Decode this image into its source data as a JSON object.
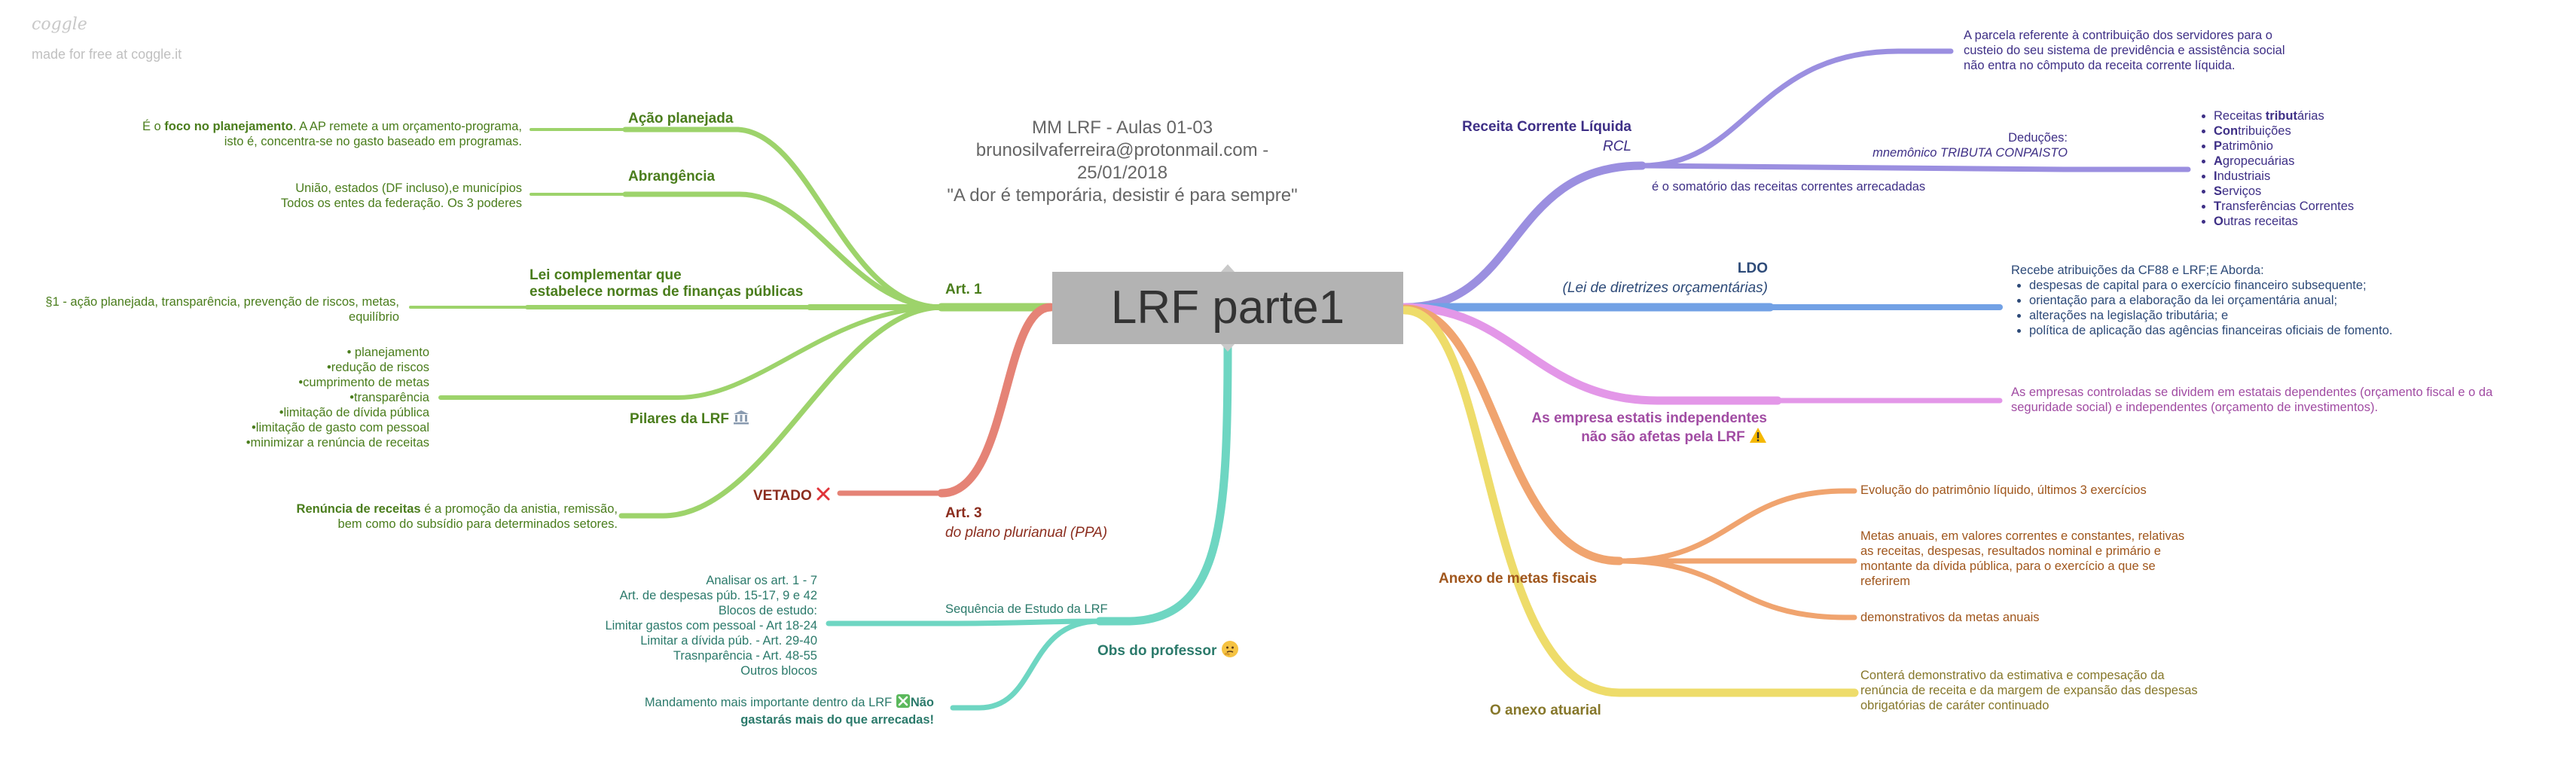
{
  "brand": {
    "logo": "coggle",
    "made_free": "made for free at coggle.it"
  },
  "header": {
    "line1": "MM LRF - Aulas 01-03",
    "line2": "brunosilvaferreira@protonmail.com - 25/01/2018",
    "line3": "\"A dor é temporária, desistir é para sempre\""
  },
  "central": "LRF parte1",
  "art1": {
    "label": "Art. 1",
    "acao": {
      "title": "Ação planejada",
      "note_pre": "É o ",
      "note_bold": "foco no planejamento",
      "note_post": ". A AP remete a um orçamento-programa,",
      "note_line2": "isto é, concentra-se no gasto baseado em programas."
    },
    "abrangencia": {
      "title": "Abrangência",
      "note_line1": "União, estados (DF incluso),e municípios",
      "note_line2": "Todos os entes da federação. Os 3 poderes"
    },
    "lei": {
      "title_line1": "Lei complementar que",
      "title_line2": "estabelece normas de finanças públicas",
      "note_line1": "§1 - ação planejada, transparência, prevenção de riscos, metas,",
      "note_line2": "equilíbrio"
    },
    "pilares": {
      "title": "Pilares da LRF",
      "icon": "bank-icon",
      "items": [
        "• planejamento",
        "•redução de riscos",
        "•cumprimento de metas",
        "•transparência",
        "•limitação de dívida pública",
        "•limitação de gasto com pessoal",
        "•minimizar a renúncia de receitas"
      ]
    },
    "renuncia": {
      "note_bold": "Renúncia de receitas",
      "note_post": " é a promoção da anistia, remissão,",
      "note_line2": "bem como do subsídio para determinados setores."
    }
  },
  "art3": {
    "title": "Art. 3",
    "subtitle": "do plano plurianual (PPA)",
    "vetado": "VETADO",
    "vetado_icon": "red-x-icon"
  },
  "obs": {
    "title": "Obs do professor",
    "icon": "thinking-face-icon",
    "sequencia": {
      "title": "Sequência de Estudo da LRF",
      "items": [
        "Analisar os art. 1 - 7",
        "Art. de despesas púb. 15-17, 9 e 42",
        "Blocos de estudo:",
        "Limitar gastos com pessoal - Art 18-24",
        "Limitar a dívida púb. - Art. 29-40",
        "Trasnparência - Art. 48-55",
        "Outros blocos"
      ]
    },
    "mandamento": {
      "pre": "Mandamento mais importante dentro da LRF ",
      "icon": "green-x-box-icon",
      "bold1": "Não",
      "bold2": "gastarás mais do que arrecadas!"
    }
  },
  "rcl": {
    "title": "Receita Corrente Líquida",
    "subtitle": "RCL",
    "parcela_note": [
      "A parcela referente à contribuição dos servidores para o",
      "custeio do seu sistema de previdência e assistência social",
      "não entra no cômputo da receita corrente líquida."
    ],
    "definicao": "é o somatório das receitas correntes arrecadadas",
    "deducoes": "Deduções:",
    "mnemonico": "mnemônico TRIBUTA CONPAISTO",
    "list": [
      {
        "pre": "Receitas ",
        "bold": "tribut",
        "post": "árias"
      },
      {
        "pre": "",
        "bold": "Con",
        "post": "tribuições"
      },
      {
        "pre": "",
        "bold": "P",
        "post": "atrimônio"
      },
      {
        "pre": "",
        "bold": "A",
        "post": "gropecuárias"
      },
      {
        "pre": "",
        "bold": "I",
        "post": "ndustriais"
      },
      {
        "pre": "",
        "bold": "S",
        "post": "erviços"
      },
      {
        "pre": "",
        "bold": "T",
        "post": "ransferências Correntes"
      },
      {
        "pre": "",
        "bold": "O",
        "post": "utras receitas"
      }
    ]
  },
  "ldo": {
    "title": "LDO",
    "subtitle": "(Lei de diretrizes orçamentárias)",
    "intro": "Recebe atribuições da CF88 e LRF;E Aborda:",
    "items": [
      "despesas de capital para o exercício financeiro subsequente;",
      "orientação para a elaboração da lei orçamentária anual;",
      "alterações na legislação tributária; e",
      "política de aplicação das agências financeiras oficiais de fomento."
    ]
  },
  "estatais": {
    "title_line1": "As empresa estatis independentes",
    "title_line2": "não são afetas pela LRF",
    "icon": "warning-icon",
    "note_line1": "As empresas controladas se dividem em estatais dependentes (orçamento fiscal e o da",
    "note_line2": "seguridade social) e independentes (orçamento de investimentos)."
  },
  "anexo_metas": {
    "title": "Anexo de metas fiscais",
    "evolucao": "Evolução do patrimônio líquido, últimos 3 exercícios",
    "metas_anuais": [
      "Metas anuais, em valores correntes e constantes, relativas",
      "as receitas, despesas, resultados nominal e primário e",
      "montante da dívida pública, para o exercício a que se",
      "referirem"
    ],
    "demonstrativos": "demonstrativos da metas anuais"
  },
  "anexo_atuarial": {
    "title": "O anexo atuarial",
    "note": [
      "Conterá demonstrativo da estimativa e compesação da",
      "renúncia de receita e da margem de expansão das despesas",
      "obrigatórias de caráter continuado"
    ]
  },
  "colors": {
    "green": "#9dd36b",
    "red": "#e58376",
    "teal": "#6ed6c2",
    "purple": "#9b8fe0",
    "blue": "#72a1e5",
    "magenta": "#e397e8",
    "orange": "#f0a46f",
    "yellow": "#eedc6a"
  }
}
